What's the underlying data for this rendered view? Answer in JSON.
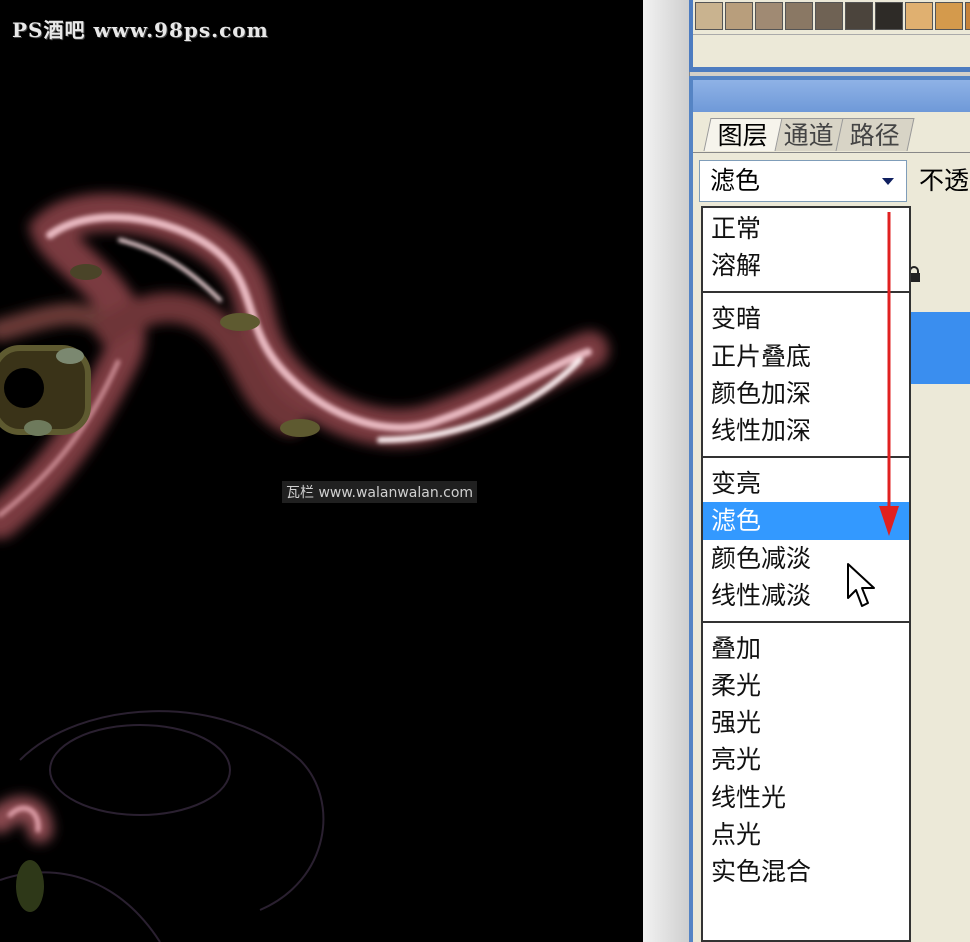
{
  "watermarks": {
    "top": "PS酒吧 www.98ps.com",
    "middle": "瓦栏 www.walanwalan.com"
  },
  "swatches": [
    "#c9b38f",
    "#b89e7c",
    "#a08a73",
    "#8a7864",
    "#6f6254",
    "#4b443c",
    "#2e2b27",
    "#e0b070",
    "#d49a4c",
    "#c5823a",
    "#b06a26",
    "#96551b",
    "#7a4414"
  ],
  "layers_panel": {
    "tabs": [
      {
        "label": "图层",
        "active": true
      },
      {
        "label": "通道",
        "active": false
      },
      {
        "label": "路径",
        "active": false
      }
    ],
    "blend_mode": "滤色",
    "opacity_label": "不透"
  },
  "blend_menu": {
    "groups": [
      [
        "正常",
        "溶解"
      ],
      [
        "变暗",
        "正片叠底",
        "颜色加深",
        "线性加深"
      ],
      [
        "变亮",
        "滤色",
        "颜色减淡",
        "线性减淡"
      ],
      [
        "叠加",
        "柔光",
        "强光",
        "亮光",
        "线性光",
        "点光",
        "实色混合"
      ]
    ],
    "selected": "滤色"
  },
  "colors": {
    "highlight": "#3399ff",
    "title_bar": "#5584c4",
    "annotation_arrow": "#e02020"
  }
}
